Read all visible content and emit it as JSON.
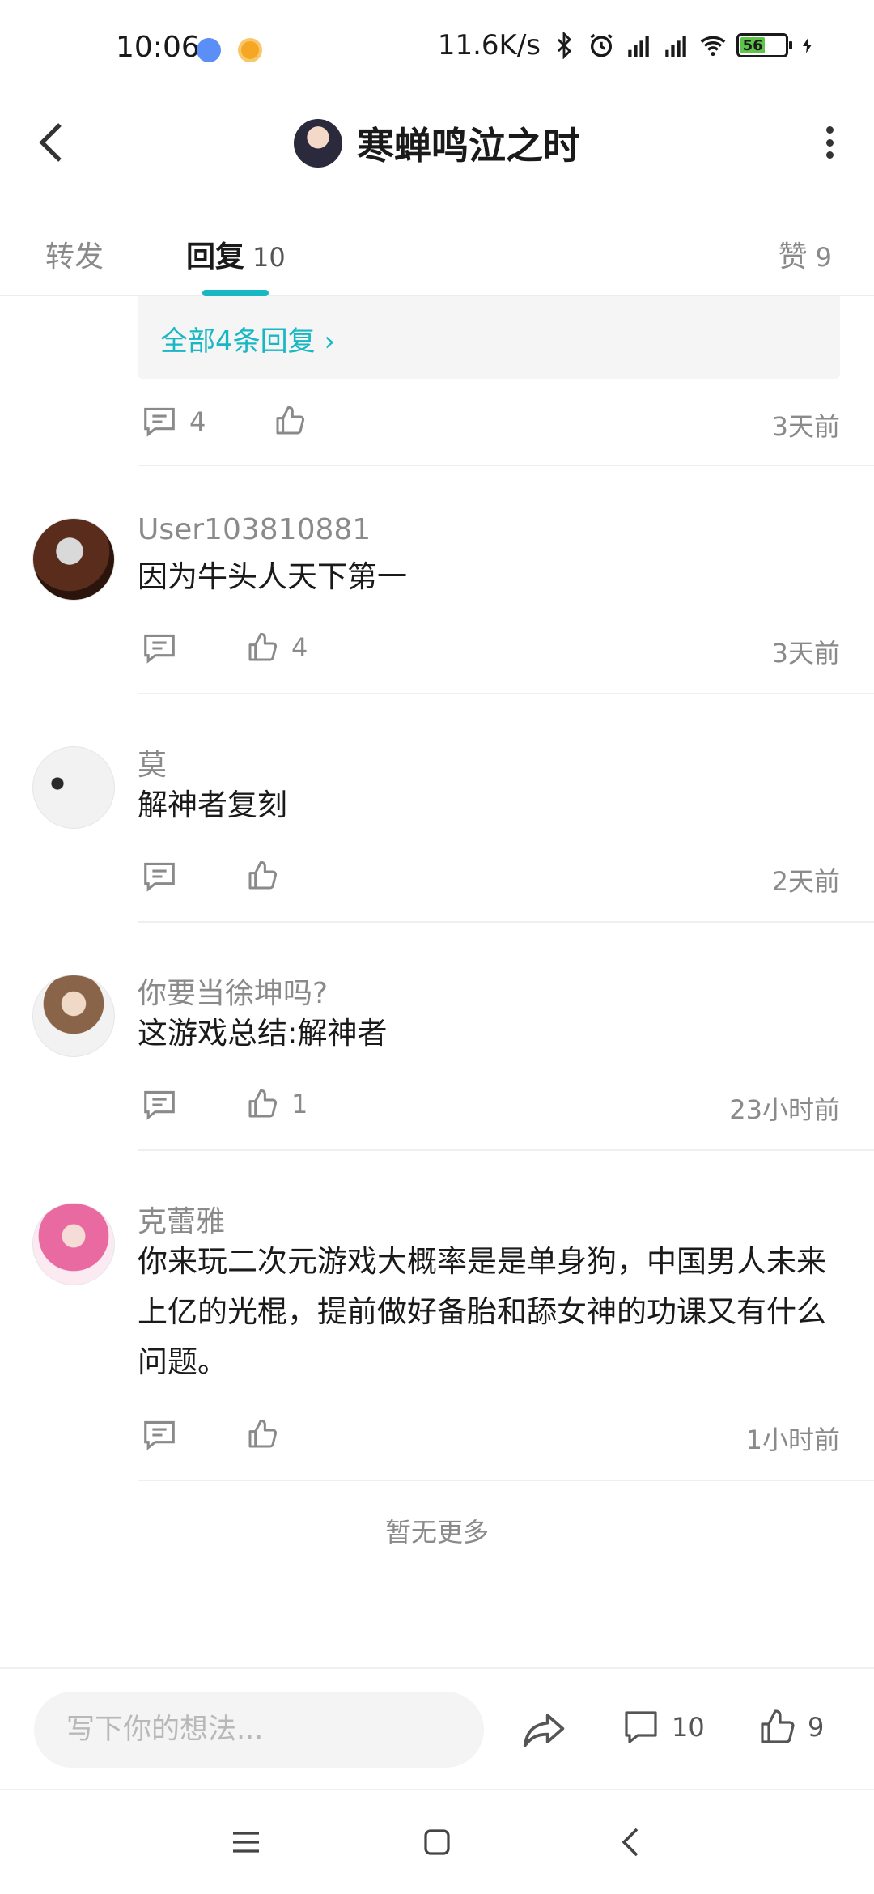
{
  "status_bar": {
    "time": "10:06",
    "network_speed": "11.6K/s",
    "battery_level": "56",
    "icons": [
      "bluetooth-icon",
      "alarm-icon",
      "signal-hd-icon",
      "signal-hd-icon",
      "wifi-icon",
      "battery-icon",
      "charging-icon"
    ]
  },
  "header": {
    "title": "寒蝉鸣泣之时"
  },
  "tabs": {
    "forward": "转发",
    "reply": "回复",
    "reply_count": "10",
    "likes": "赞",
    "likes_count": "9"
  },
  "subreply": {
    "link": "全部4条回复 ›"
  },
  "top_actions": {
    "reply_count": "4",
    "time": "3天前"
  },
  "comments": [
    {
      "user": "User103810881",
      "text": "因为牛头人天下第一",
      "reply_count": "",
      "like_count": "4",
      "time": "3天前"
    },
    {
      "user": "莫",
      "text": "解神者复刻",
      "reply_count": "",
      "like_count": "",
      "time": "2天前"
    },
    {
      "user": "你要当徐坤吗?",
      "text": "这游戏总结:解神者",
      "reply_count": "",
      "like_count": "1",
      "time": "23小时前"
    },
    {
      "user": "克蕾雅",
      "text": "你来玩二次元游戏大概率是是单身狗，中国男人未来上亿的光棍，提前做好备胎和舔女神的功课又有什么问题。",
      "reply_count": "",
      "like_count": "",
      "time": "1小时前"
    }
  ],
  "footer_note": "暂无更多",
  "bottom_bar": {
    "input_placeholder": "写下你的想法...",
    "comment_count": "10",
    "like_count": "9"
  },
  "colors": {
    "accent": "#18b7c4",
    "text_secondary": "#8a8a8a",
    "battery_fill": "#5fc44a"
  }
}
